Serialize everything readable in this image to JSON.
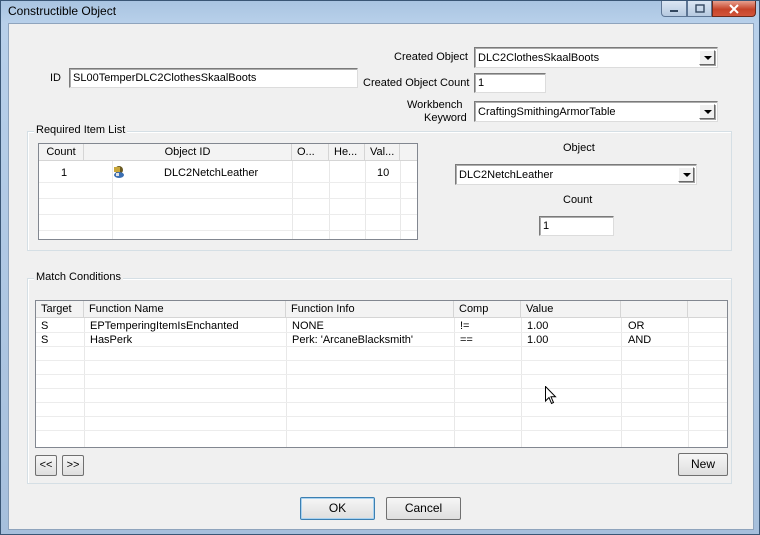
{
  "window": {
    "title": "Constructible Object"
  },
  "form": {
    "id_label": "ID",
    "id_value": "SL00TemperDLC2ClothesSkaalBoots",
    "created_object_label": "Created Object",
    "created_object_value": "DLC2ClothesSkaalBoots",
    "created_count_label": "Created Object Count",
    "created_count_value": "1",
    "workbench_label_line1": "Workbench",
    "workbench_label_line2": "Keyword",
    "workbench_value": "CraftingSmithingArmorTable"
  },
  "required_items": {
    "group_title": "Required Item List",
    "columns": [
      "Count",
      "Object ID",
      "O...",
      "He...",
      "Val..."
    ],
    "rows": [
      {
        "count": "1",
        "object_id": "DLC2NetchLeather",
        "o": "",
        "he": "",
        "val": "10"
      }
    ],
    "object_label": "Object",
    "object_value": "DLC2NetchLeather",
    "count_label": "Count",
    "count_value": "1"
  },
  "match_conditions": {
    "group_title": "Match Conditions",
    "columns": [
      "Target",
      "Function Name",
      "Function Info",
      "Comp",
      "Value",
      ""
    ],
    "rows": [
      {
        "target": "S",
        "function_name": "EPTemperingItemIsEnchanted",
        "function_info": "NONE",
        "comp": "!=",
        "value": "1.00",
        "logic": "OR"
      },
      {
        "target": "S",
        "function_name": "HasPerk",
        "function_info": "Perk: 'ArcaneBlacksmith'",
        "comp": "==",
        "value": "1.00",
        "logic": "AND"
      }
    ],
    "prev_label": "<<",
    "next_label": ">>",
    "new_label": "New"
  },
  "footer": {
    "ok_label": "OK",
    "cancel_label": "Cancel"
  }
}
